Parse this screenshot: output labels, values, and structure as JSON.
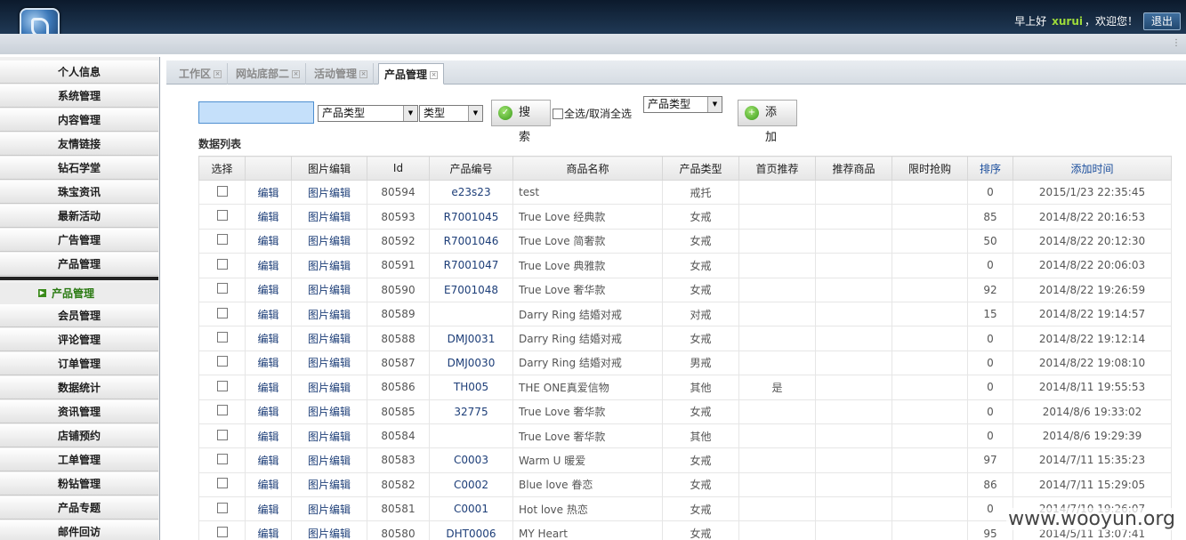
{
  "header": {
    "greeting": "早上好",
    "username": "xurui",
    "welcome": "，欢迎您！",
    "logout_label": "退出"
  },
  "sidebar": {
    "items": [
      "个人信息",
      "系统管理",
      "内容管理",
      "友情链接",
      "钻石学堂",
      "珠宝资讯",
      "最新活动",
      "广告管理",
      "产品管理"
    ],
    "active_group": "产品管理",
    "sub_items": [
      "会员管理",
      "评论管理",
      "订单管理",
      "数据统计",
      "资讯管理",
      "店铺预约",
      "工单管理",
      "粉钻管理",
      "产品专题",
      "邮件回访"
    ]
  },
  "tabs": [
    {
      "label": "工作区",
      "active": false
    },
    {
      "label": "网站底部二",
      "active": false
    },
    {
      "label": "活动管理",
      "active": false
    },
    {
      "label": "产品管理",
      "active": true
    }
  ],
  "toolbar": {
    "search_value": "",
    "product_type_select": "产品类型",
    "type_select": "类型",
    "search_button": "搜 索",
    "select_all_label": "全选/取消全选",
    "product_type_select_2": "产品类型",
    "add_button": "添 加"
  },
  "list_title": "数据列表",
  "table": {
    "columns": [
      "选择",
      "",
      "图片编辑",
      "Id",
      "产品编号",
      "商品名称",
      "产品类型",
      "首页推荐",
      "推荐商品",
      "限时抢购",
      "排序",
      "添加时间"
    ],
    "edit_label": "编辑",
    "image_edit_label": "图片编辑",
    "rows": [
      {
        "id": "80594",
        "code": "e23s23",
        "name": "test",
        "type": "戒托",
        "home": "",
        "sort": "0",
        "time": "2015/1/23 22:35:45"
      },
      {
        "id": "80593",
        "code": "R7001045",
        "name": "True Love 经典款",
        "type": "女戒",
        "home": "",
        "sort": "85",
        "time": "2014/8/22 20:16:53"
      },
      {
        "id": "80592",
        "code": "R7001046",
        "name": "True Love 简奢款",
        "type": "女戒",
        "home": "",
        "sort": "50",
        "time": "2014/8/22 20:12:30"
      },
      {
        "id": "80591",
        "code": "R7001047",
        "name": "True Love 典雅款",
        "type": "女戒",
        "home": "",
        "sort": "0",
        "time": "2014/8/22 20:06:03"
      },
      {
        "id": "80590",
        "code": "E7001048",
        "name": "True Love 奢华款",
        "type": "女戒",
        "home": "",
        "sort": "92",
        "time": "2014/8/22 19:26:59"
      },
      {
        "id": "80589",
        "code": "",
        "name": "Darry Ring 结婚对戒",
        "type": "对戒",
        "home": "",
        "sort": "15",
        "time": "2014/8/22 19:14:57"
      },
      {
        "id": "80588",
        "code": "DMJ0031",
        "name": "Darry Ring 结婚对戒",
        "type": "女戒",
        "home": "",
        "sort": "0",
        "time": "2014/8/22 19:12:14"
      },
      {
        "id": "80587",
        "code": "DMJ0030",
        "name": "Darry Ring 结婚对戒",
        "type": "男戒",
        "home": "",
        "sort": "0",
        "time": "2014/8/22 19:08:10"
      },
      {
        "id": "80586",
        "code": "TH005",
        "name": "THE ONE真爱信物",
        "type": "其他",
        "home": "是",
        "sort": "0",
        "time": "2014/8/11 19:55:53"
      },
      {
        "id": "80585",
        "code": "32775",
        "name": "True Love 奢华款",
        "type": "女戒",
        "home": "",
        "sort": "0",
        "time": "2014/8/6 19:33:02"
      },
      {
        "id": "80584",
        "code": "",
        "name": "True Love 奢华款",
        "type": "其他",
        "home": "",
        "sort": "0",
        "time": "2014/8/6 19:29:39"
      },
      {
        "id": "80583",
        "code": "C0003",
        "name": "Warm U 暖爱",
        "type": "女戒",
        "home": "",
        "sort": "97",
        "time": "2014/7/11 15:35:23"
      },
      {
        "id": "80582",
        "code": "C0002",
        "name": "Blue love 眷恋",
        "type": "女戒",
        "home": "",
        "sort": "86",
        "time": "2014/7/11 15:29:05"
      },
      {
        "id": "80581",
        "code": "C0001",
        "name": "Hot love 热恋",
        "type": "女戒",
        "home": "",
        "sort": "0",
        "time": "2014/7/10 19:26:07"
      },
      {
        "id": "80580",
        "code": "DHT0006",
        "name": "MY Heart",
        "type": "女戒",
        "home": "",
        "sort": "95",
        "time": "2014/5/11 13:07:41"
      }
    ]
  },
  "watermark": "www.wooyun.org"
}
